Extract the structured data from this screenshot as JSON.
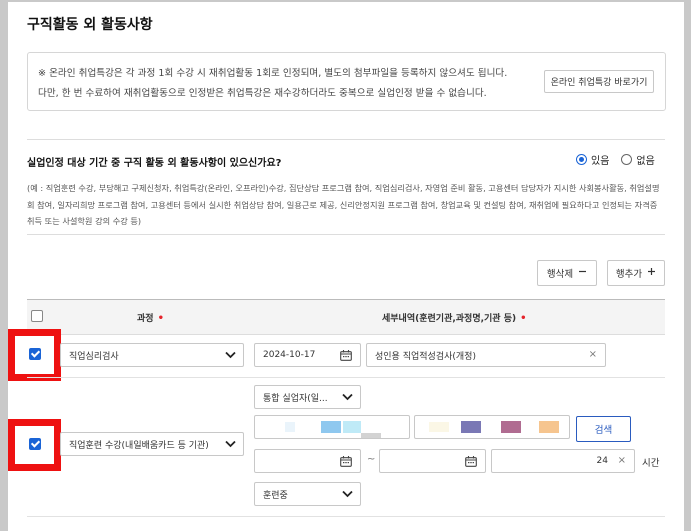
{
  "section_title": "구직활동 외 활동사항",
  "notice": {
    "line1": "※ 온라인 취업특강은 각 과정 1회 수강 시 재취업활동 1회로 인정되며, 별도의 첨부파일을 등록하지 않으셔도 됩니다.",
    "line2": "다만, 한 번 수료하여 재취업활동으로 인정받은 취업특강은 재수강하더라도 중복으로 실업인정 받을 수 없습니다.",
    "link_button": "온라인 취업특강 바로가기"
  },
  "question": "실업인정 대상 기간 중 구직 활동 외 활동사항이 있으신가요?",
  "radio": {
    "yes": "있음",
    "no": "없음",
    "selected": "yes"
  },
  "example_text": "(예 : 직업훈련 수강, 부당해고 구제신청자, 취업특강(온라인, 오프라인)수강, 집단상담 프로그램 참여, 직업심리검사, 자영업 준비 활동, 고용센터 담당자가 지시한 사회봉사활동, 취업설명회 참여, 일자리희망 프로그램 참여, 고용센터 등에서 실시한 취업상담 참여, 일용근로 제공, 신리안정지원 프로그램 참여, 창업교육 및 컨설팅 참여, 재취업에 필요하다고 인정되는 자격증 취득 또는 사설학원 강의 수강 등)",
  "actions": {
    "delete_row": "행삭제",
    "add_row": "행추가"
  },
  "table": {
    "col_course": "과정",
    "col_detail": "세부내역(훈련기관,과정명,기관 등)",
    "rows": [
      {
        "course": "직업심리검사",
        "date": "2024-10-17",
        "detail": "성인용 직업적성검사(개정)",
        "checked": true
      },
      {
        "course": "직업훈련 수강(내일배움카드 등 기관)",
        "type": "통합 실업자(일...",
        "search": "검색",
        "hours": "24",
        "hours_unit": "시간",
        "status": "훈련중",
        "checked": true,
        "tilde": "~"
      }
    ]
  },
  "colors": {
    "accent": "#1a64d6",
    "highlight": "#ee1111",
    "required": "#e5242b"
  }
}
